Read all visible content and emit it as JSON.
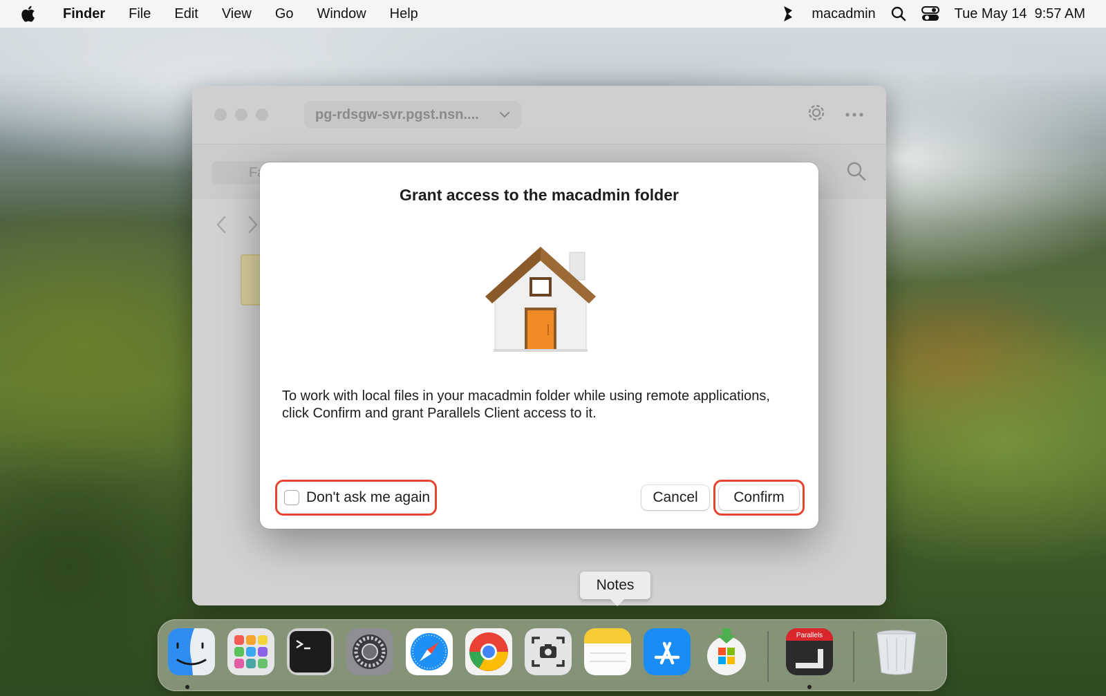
{
  "menubar": {
    "app_name": "Finder",
    "menus": [
      "File",
      "Edit",
      "View",
      "Go",
      "Window",
      "Help"
    ],
    "user": "macadmin",
    "clock": "Tue May 14  9:57 AM"
  },
  "finder": {
    "path": "pg-rdsgw-svr.pgst.nsn....",
    "toolbar_field_text": "Fa"
  },
  "dialog": {
    "title": "Grant access to the macadmin folder",
    "message": "To work with local files in your macadmin folder while using remote applications, click Confirm and grant Parallels Client access to it.",
    "checkbox_label": "Don't ask me again",
    "checkbox_checked": false,
    "cancel_label": "Cancel",
    "confirm_label": "Confirm",
    "highlight_color": "#e5452f"
  },
  "dock": {
    "tooltip": "Notes",
    "parallels_badge": "Parallels",
    "apps": [
      "finder-icon",
      "launchpad-icon",
      "terminal-icon",
      "system-settings-icon",
      "safari-icon",
      "chrome-icon",
      "screenshot-icon",
      "notes-icon",
      "app-store-icon",
      "company-portal-icon",
      "parallels-client-icon",
      "trash-icon"
    ]
  }
}
